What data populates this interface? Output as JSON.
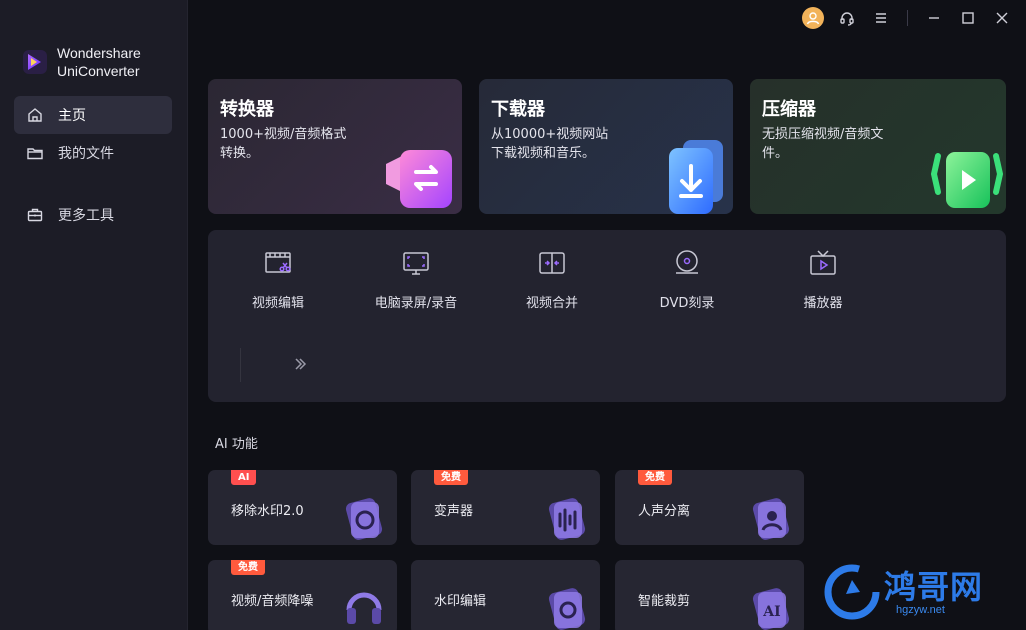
{
  "brand": {
    "line1": "Wondershare",
    "line2": "UniConverter"
  },
  "nav": [
    {
      "label": "主页",
      "icon": "home-icon",
      "active": true
    },
    {
      "label": "我的文件",
      "icon": "folder-icon",
      "active": false
    },
    {
      "label": "更多工具",
      "icon": "toolbox-icon",
      "active": false
    }
  ],
  "heroes": [
    {
      "title": "转换器",
      "desc": "1000+视频/音频格式转换。"
    },
    {
      "title": "下载器",
      "desc": "从10000+视频网站下载视频和音乐。"
    },
    {
      "title": "压缩器",
      "desc": "无损压缩视频/音频文件。"
    }
  ],
  "tools": [
    {
      "label": "视频编辑",
      "icon": "video-edit-icon"
    },
    {
      "label": "电脑录屏/录音",
      "icon": "screen-record-icon"
    },
    {
      "label": "视频合并",
      "icon": "video-merge-icon"
    },
    {
      "label": "DVD刻录",
      "icon": "dvd-burn-icon"
    },
    {
      "label": "播放器",
      "icon": "player-icon"
    }
  ],
  "ai_section": {
    "title": "AI 功能"
  },
  "ai_cards": [
    {
      "label": "移除水印2.0",
      "badge": "AI"
    },
    {
      "label": "变声器",
      "badge": "免费"
    },
    {
      "label": "人声分离",
      "badge": "免费"
    },
    {
      "label": "视频/音频降噪",
      "badge": "免费"
    },
    {
      "label": "水印编辑",
      "badge": ""
    },
    {
      "label": "智能裁剪",
      "badge": ""
    }
  ],
  "watermark": {
    "text": "鸿哥网",
    "url": "hgzyw.net"
  },
  "colors": {
    "accent": "#8a5cf6",
    "badge": "#ff5a3d",
    "bg": "#0f1016",
    "sidebar": "#1c1c26"
  }
}
